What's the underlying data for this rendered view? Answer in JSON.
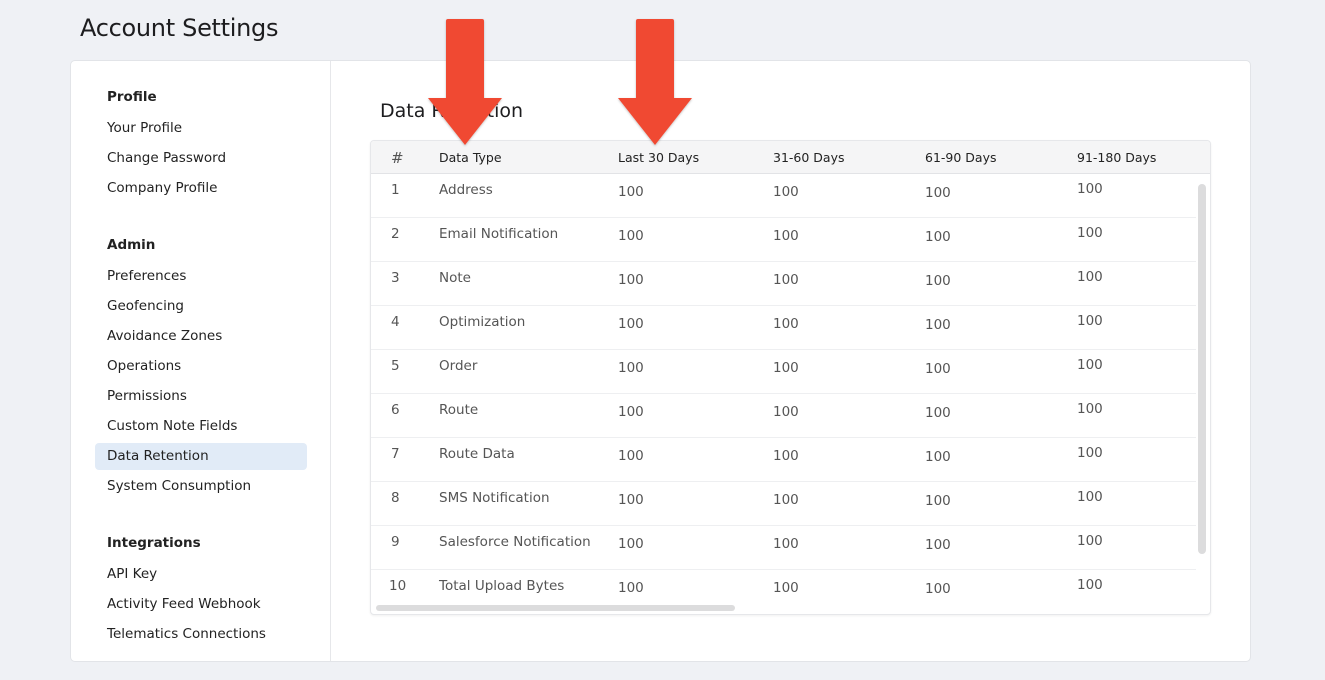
{
  "page": {
    "title": "Account Settings"
  },
  "sidebar": {
    "sections": [
      {
        "heading": "Profile",
        "items": [
          "Your Profile",
          "Change Password",
          "Company Profile"
        ]
      },
      {
        "heading": "Admin",
        "items": [
          "Preferences",
          "Geofencing",
          "Avoidance Zones",
          "Operations",
          "Permissions",
          "Custom Note Fields",
          "Data Retention",
          "System Consumption"
        ]
      },
      {
        "heading": "Integrations",
        "items": [
          "API Key",
          "Activity Feed Webhook",
          "Telematics Connections"
        ]
      }
    ],
    "active_item": "Data Retention"
  },
  "content": {
    "title": "Data Retention",
    "table": {
      "columns": [
        "#",
        "Data Type",
        "Last 30 Days",
        "31-60 Days",
        "61-90 Days",
        "91-180 Days"
      ],
      "rows": [
        [
          "1",
          "Address",
          "100",
          "100",
          "100",
          "100"
        ],
        [
          "2",
          "Email Notification",
          "100",
          "100",
          "100",
          "100"
        ],
        [
          "3",
          "Note",
          "100",
          "100",
          "100",
          "100"
        ],
        [
          "4",
          "Optimization",
          "100",
          "100",
          "100",
          "100"
        ],
        [
          "5",
          "Order",
          "100",
          "100",
          "100",
          "100"
        ],
        [
          "6",
          "Route",
          "100",
          "100",
          "100",
          "100"
        ],
        [
          "7",
          "Route Data",
          "100",
          "100",
          "100",
          "100"
        ],
        [
          "8",
          "SMS Notification",
          "100",
          "100",
          "100",
          "100"
        ],
        [
          "9",
          "Salesforce Notification",
          "100",
          "100",
          "100",
          "100"
        ],
        [
          "10",
          "Total Upload Bytes",
          "100",
          "100",
          "100",
          "100"
        ]
      ]
    }
  },
  "annotations": {
    "arrow_color": "#f04a32",
    "arrows": [
      "points-to-data-type-column",
      "points-to-last-30-days-column"
    ]
  }
}
